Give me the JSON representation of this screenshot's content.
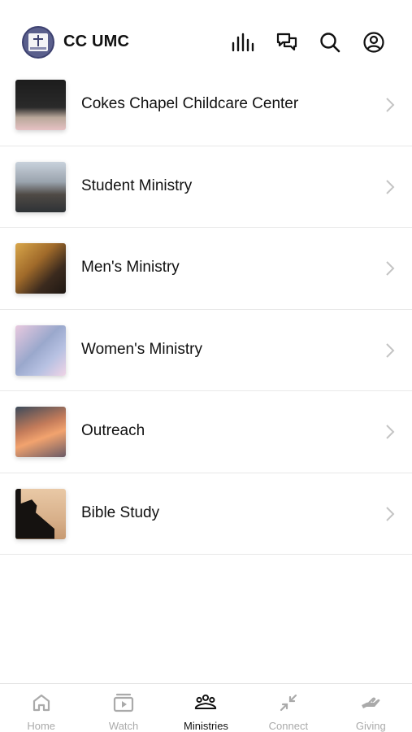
{
  "header": {
    "app_title": "CC UMC",
    "icons": [
      "church-logo-icon",
      "audio-bars-icon",
      "chat-icon",
      "search-icon",
      "profile-icon"
    ]
  },
  "ministries": [
    {
      "label": "Cokes Chapel Childcare Center",
      "thumb": "bible-tulips-photo"
    },
    {
      "label": "Student Ministry",
      "thumb": "lake-house-mountains-photo"
    },
    {
      "label": "Men's Ministry",
      "thumb": "reading-book-photo"
    },
    {
      "label": "Women's Ministry",
      "thumb": "pastel-clouds-photo"
    },
    {
      "label": "Outreach",
      "thumb": "sunset-clouds-photo"
    },
    {
      "label": "Bible Study",
      "thumb": "reading-silhouette-photo"
    }
  ],
  "tabbar": {
    "active": "Ministries",
    "tabs": [
      {
        "label": "Home",
        "icon": "home-icon"
      },
      {
        "label": "Watch",
        "icon": "play-icon"
      },
      {
        "label": "Ministries",
        "icon": "people-icon"
      },
      {
        "label": "Connect",
        "icon": "arrows-in-icon"
      },
      {
        "label": "Giving",
        "icon": "hand-icon"
      }
    ]
  },
  "colors": {
    "active": "#111111",
    "inactive": "#aaaaaa",
    "divider": "#e8e8e8"
  }
}
